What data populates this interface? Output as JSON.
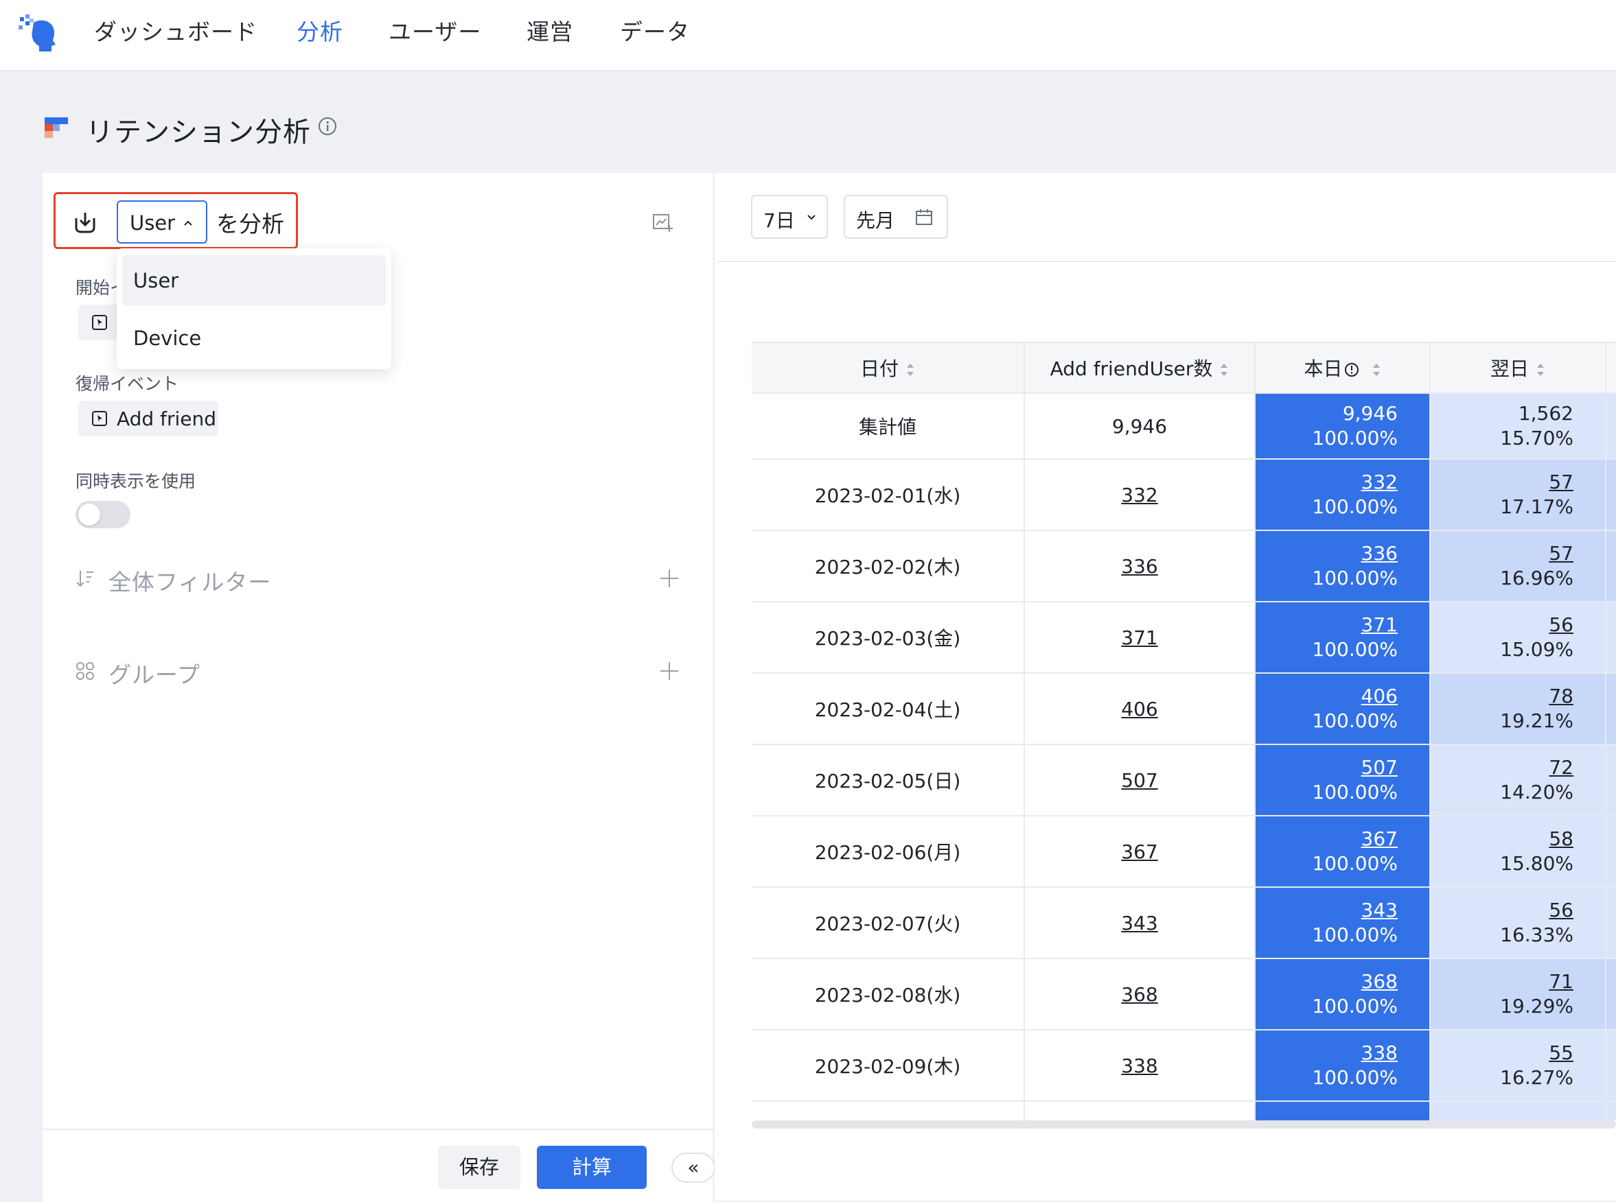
{
  "nav": {
    "items": [
      {
        "label": "ダッシュボード",
        "active": false
      },
      {
        "label": "分析",
        "active": true
      },
      {
        "label": "ユーザー",
        "active": false
      },
      {
        "label": "運営",
        "active": false
      },
      {
        "label": "データ",
        "active": false
      }
    ]
  },
  "page": {
    "title": "リテンション分析"
  },
  "left": {
    "subject_value": "User",
    "analyze_suffix": "を分析",
    "dropdown_options": [
      "User",
      "Device"
    ],
    "start_event_label": "開始イ",
    "return_event_label": "復帰イベント",
    "return_event_value": "Add friend",
    "simultaneous_label": "同時表示を使用",
    "simultaneous_on": false,
    "global_filter_label": "全体フィルター",
    "group_label": "グループ"
  },
  "footer": {
    "save_label": "保存",
    "calc_label": "計算",
    "collapse_label": "«"
  },
  "controls": {
    "period": "7日",
    "date_range": "先月"
  },
  "table": {
    "headers": [
      "日付",
      "Add friendUser数",
      "本日",
      "翌日"
    ],
    "total": {
      "label": "集計値",
      "count": "9,946",
      "day0_value": "9,946",
      "day0_pct": "100.00%",
      "day1_value": "1,562",
      "day1_pct": "15.70%"
    },
    "rows": [
      {
        "date": "2023-02-01(水)",
        "count": "332",
        "day0_value": "332",
        "day0_pct": "100.00%",
        "day1_value": "57",
        "day1_pct": "17.17%"
      },
      {
        "date": "2023-02-02(木)",
        "count": "336",
        "day0_value": "336",
        "day0_pct": "100.00%",
        "day1_value": "57",
        "day1_pct": "16.96%"
      },
      {
        "date": "2023-02-03(金)",
        "count": "371",
        "day0_value": "371",
        "day0_pct": "100.00%",
        "day1_value": "56",
        "day1_pct": "15.09%"
      },
      {
        "date": "2023-02-04(土)",
        "count": "406",
        "day0_value": "406",
        "day0_pct": "100.00%",
        "day1_value": "78",
        "day1_pct": "19.21%"
      },
      {
        "date": "2023-02-05(日)",
        "count": "507",
        "day0_value": "507",
        "day0_pct": "100.00%",
        "day1_value": "72",
        "day1_pct": "14.20%"
      },
      {
        "date": "2023-02-06(月)",
        "count": "367",
        "day0_value": "367",
        "day0_pct": "100.00%",
        "day1_value": "58",
        "day1_pct": "15.80%"
      },
      {
        "date": "2023-02-07(火)",
        "count": "343",
        "day0_value": "343",
        "day0_pct": "100.00%",
        "day1_value": "56",
        "day1_pct": "16.33%"
      },
      {
        "date": "2023-02-08(水)",
        "count": "368",
        "day0_value": "368",
        "day0_pct": "100.00%",
        "day1_value": "71",
        "day1_pct": "19.29%"
      },
      {
        "date": "2023-02-09(木)",
        "count": "338",
        "day0_value": "338",
        "day0_pct": "100.00%",
        "day1_value": "55",
        "day1_pct": "16.27%"
      }
    ]
  },
  "colors": {
    "accent": "#2f6fe8",
    "day0_cell": "#3371e6",
    "day1_dark": "#c8d8f8",
    "day1_light": "#dae5fb",
    "highlight_border": "#e5402a"
  }
}
